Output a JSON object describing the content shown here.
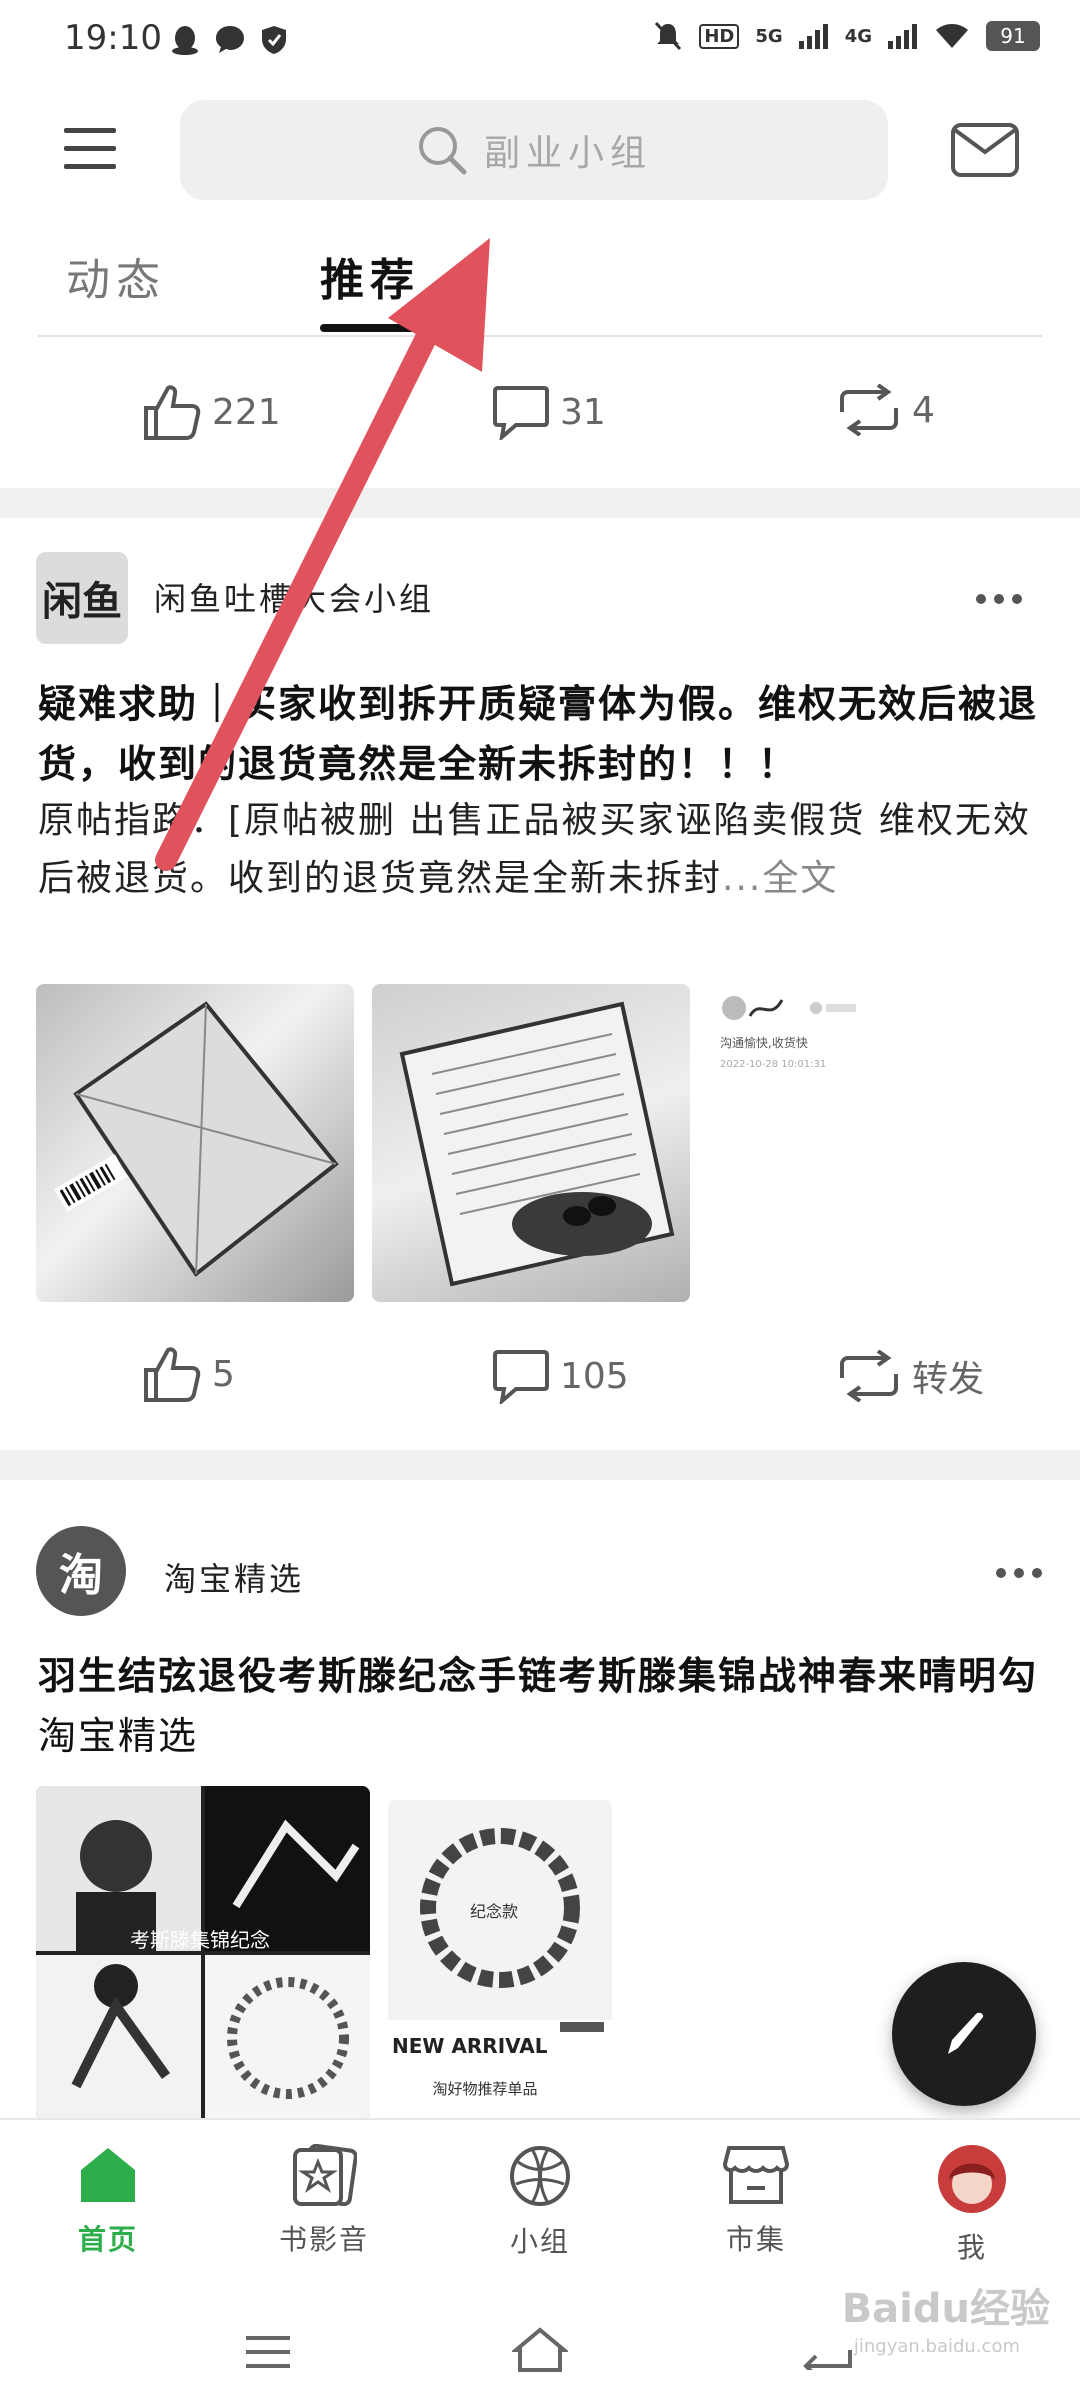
{
  "status_bar": {
    "time": "19:10",
    "battery": "91",
    "network_1": "5G",
    "network_2": "4G",
    "hd": "HD"
  },
  "search": {
    "placeholder": "副业小组"
  },
  "tabs": [
    {
      "label": "动态"
    },
    {
      "label": "推荐"
    }
  ],
  "post0_actions": {
    "likes": "221",
    "comments": "31",
    "reposts": "4"
  },
  "post1": {
    "group": "闲鱼吐槽大会小组",
    "avatar_text": "闲鱼",
    "title": "疑难求助｜买家收到拆开质疑膏体为假。维权无效后被退货，收到的退货竟然是全新未拆封的！！！",
    "body": "原帖指路：[原帖被删 出售正品被买家诬陷卖假货 维权无效后被退货。收到的退货竟然是全新未拆封",
    "read_more": "...全文",
    "review_text": "沟通愉快,收货快",
    "review_time": "2022-10-28 10:01:31",
    "actions": {
      "likes": "5",
      "comments": "105",
      "repost": "转发"
    }
  },
  "post2": {
    "group": "淘宝精选",
    "avatar_text": "淘",
    "title": "羽生结弦退役考斯滕纪念手链考斯滕集锦战神春来晴明勾",
    "title_suffix": "淘宝精选",
    "img1_caption": "考斯滕集锦纪念",
    "img2_caption": "纪念款",
    "new_arrival": "NEW ARRIVAL",
    "new_arrival_sub": "淘好物推荐单品"
  },
  "bottom_nav": [
    {
      "label": "首页",
      "active": true
    },
    {
      "label": "书影音",
      "active": false
    },
    {
      "label": "小组",
      "active": false
    },
    {
      "label": "市集",
      "active": false
    },
    {
      "label": "我",
      "active": false
    }
  ],
  "watermark": {
    "main": "Baidu经验",
    "sub": "jingyan.baidu.com"
  },
  "colors": {
    "accent": "#2eae4a",
    "annotation_arrow": "#e0525c"
  }
}
